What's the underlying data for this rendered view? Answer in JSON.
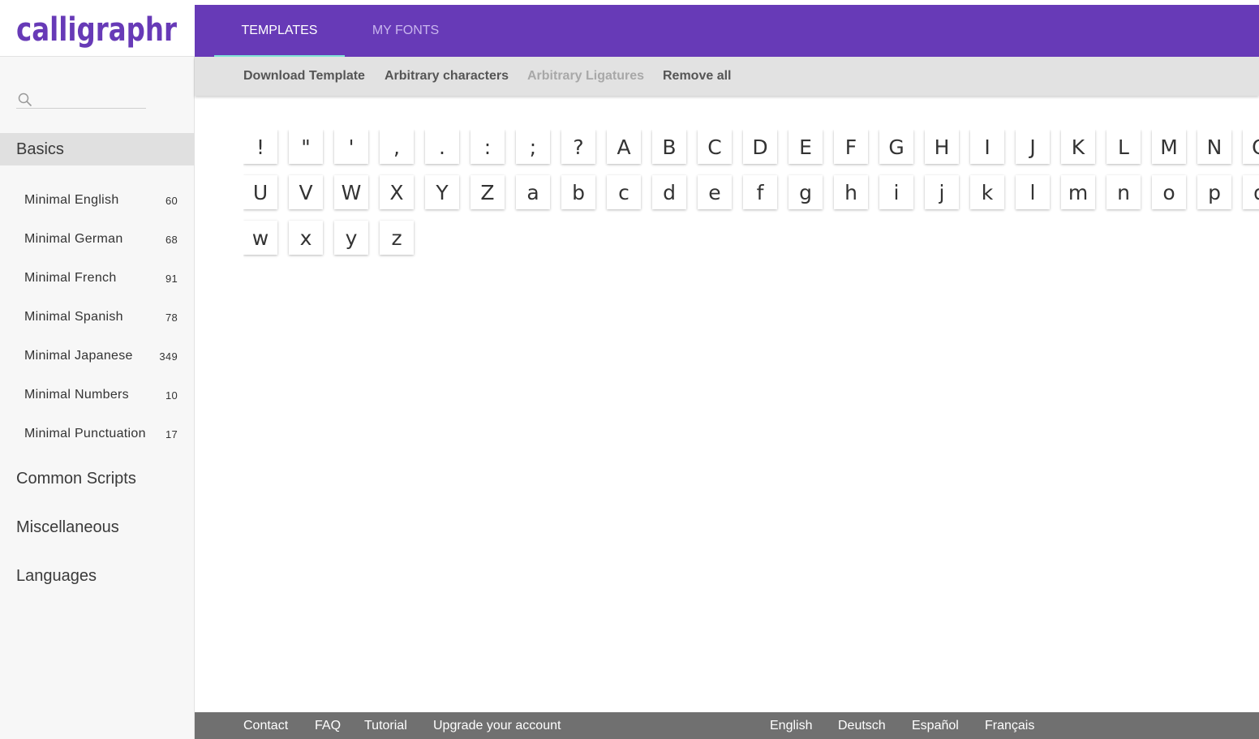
{
  "app": {
    "logo_text": "calligraphr",
    "brand_color": "#673ab7",
    "accent_color": "#7fe3d8"
  },
  "header": {
    "tabs": [
      {
        "label": "TEMPLATES",
        "active": true
      },
      {
        "label": "MY FONTS",
        "active": false
      }
    ]
  },
  "toolbar": {
    "buttons": [
      {
        "label": "Download Template",
        "enabled": true
      },
      {
        "label": "Arbitrary characters",
        "enabled": true
      },
      {
        "label": "Arbitrary Ligatures",
        "enabled": false
      },
      {
        "label": "Remove all",
        "enabled": true
      }
    ]
  },
  "sidebar": {
    "search": {
      "placeholder": "",
      "value": "",
      "icon": "search-icon"
    },
    "categories": [
      {
        "label": "Basics",
        "active": true
      },
      {
        "label": "Common Scripts",
        "active": false
      },
      {
        "label": "Miscellaneous",
        "active": false
      },
      {
        "label": "Languages",
        "active": false
      }
    ],
    "items": [
      {
        "label": "Minimal English",
        "count": "60"
      },
      {
        "label": "Minimal German",
        "count": "68"
      },
      {
        "label": "Minimal French",
        "count": "91"
      },
      {
        "label": "Minimal Spanish",
        "count": "78"
      },
      {
        "label": "Minimal Japanese",
        "count": "349"
      },
      {
        "label": "Minimal Numbers",
        "count": "10"
      },
      {
        "label": "Minimal Punctuation",
        "count": "17"
      }
    ]
  },
  "characters": [
    "!",
    "\"",
    "'",
    ",",
    ".",
    ":",
    ";",
    "?",
    "A",
    "B",
    "C",
    "D",
    "E",
    "F",
    "G",
    "H",
    "I",
    "J",
    "K",
    "L",
    "M",
    "N",
    "O",
    "U",
    "V",
    "W",
    "X",
    "Y",
    "Z",
    "a",
    "b",
    "c",
    "d",
    "e",
    "f",
    "g",
    "h",
    "i",
    "j",
    "k",
    "l",
    "m",
    "n",
    "o",
    "p",
    "q",
    "w",
    "x",
    "y",
    "z"
  ],
  "footer": {
    "links": [
      "Contact",
      "FAQ",
      "Tutorial",
      "Upgrade your account"
    ],
    "languages": [
      "English",
      "Deutsch",
      "Español",
      "Français"
    ]
  }
}
